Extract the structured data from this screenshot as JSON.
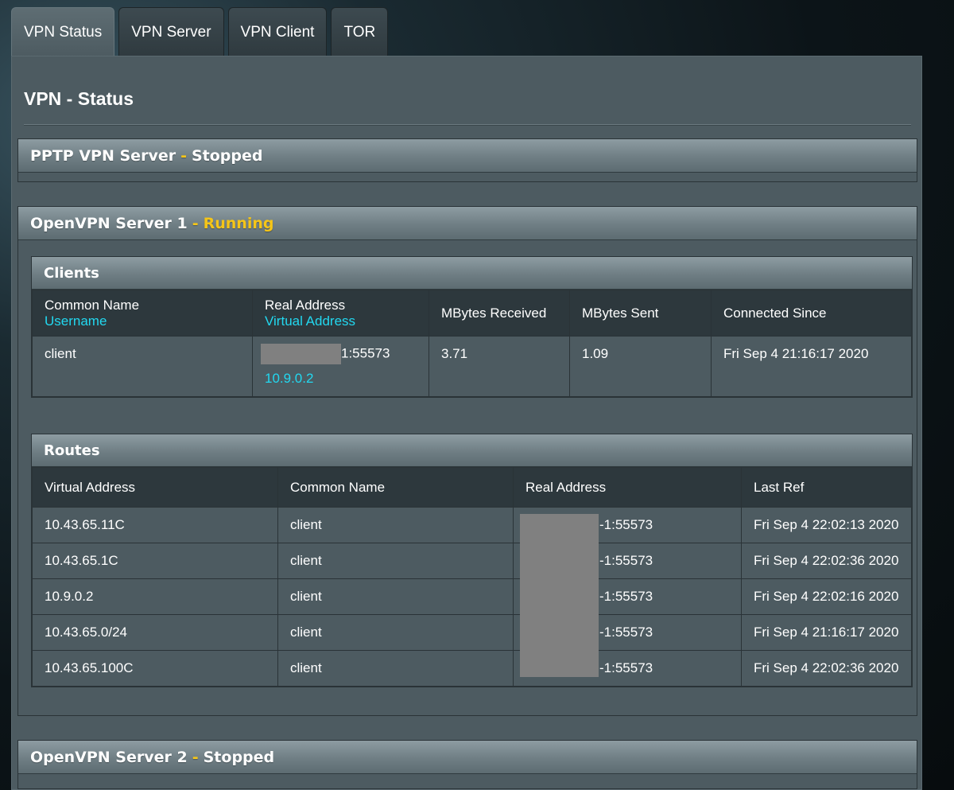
{
  "tabs": [
    {
      "label": "VPN Status",
      "active": true
    },
    {
      "label": "VPN Server",
      "active": false
    },
    {
      "label": "VPN Client",
      "active": false
    },
    {
      "label": "TOR",
      "active": false
    }
  ],
  "page_title": "VPN - Status",
  "sections": {
    "pptp": {
      "name": "PPTP VPN Server",
      "separator": "-",
      "status": "Stopped"
    },
    "ovpn1": {
      "name": "OpenVPN Server 1",
      "separator": "-",
      "status": "Running"
    },
    "ovpn2": {
      "name": "OpenVPN Server 2",
      "separator": "-",
      "status": "Stopped"
    }
  },
  "clients": {
    "title": "Clients",
    "headers": {
      "common_name": "Common Name",
      "username": "Username",
      "real_address": "Real Address",
      "virtual_address": "Virtual Address",
      "mbytes_received": "MBytes Received",
      "mbytes_sent": "MBytes Sent",
      "connected_since": "Connected Since"
    },
    "rows": [
      {
        "common_name": "client",
        "real_address_suffix": "1:55573",
        "virtual_address": "10.9.0.2",
        "mbytes_received": "3.71",
        "mbytes_sent": "1.09",
        "connected_since": "Fri Sep 4 21:16:17 2020"
      }
    ]
  },
  "routes": {
    "title": "Routes",
    "headers": {
      "virtual_address": "Virtual Address",
      "common_name": "Common Name",
      "real_address": "Real Address",
      "last_ref": "Last Ref"
    },
    "rows": [
      {
        "virtual_address": "10.43.65.11C",
        "common_name": "client",
        "real_address_suffix": "-1:55573",
        "last_ref": "Fri Sep 4 22:02:13 2020"
      },
      {
        "virtual_address": "10.43.65.1C",
        "common_name": "client",
        "real_address_suffix": "-1:55573",
        "last_ref": "Fri Sep 4 22:02:36 2020"
      },
      {
        "virtual_address": "10.9.0.2",
        "common_name": "client",
        "real_address_suffix": "-1:55573",
        "last_ref": "Fri Sep 4 22:02:16 2020"
      },
      {
        "virtual_address": "10.43.65.0/24",
        "common_name": "client",
        "real_address_suffix": "-1:55573",
        "last_ref": "Fri Sep 4 21:16:17 2020"
      },
      {
        "virtual_address": "10.43.65.100C",
        "common_name": "client",
        "real_address_suffix": "-1:55573",
        "last_ref": "Fri Sep 4 22:02:36 2020"
      }
    ]
  },
  "colors": {
    "accent_status": "#f5c518",
    "link_cyan": "#22d8f0",
    "panel_bg": "#4d5b61"
  }
}
